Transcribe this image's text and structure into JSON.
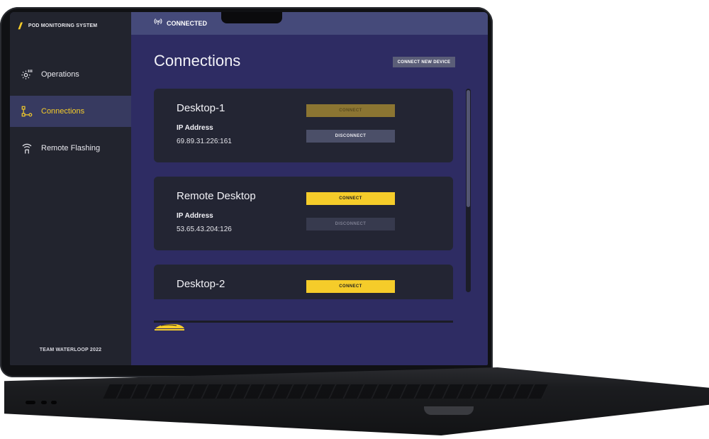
{
  "app": {
    "name": "POD MONITORING SYSTEM",
    "logo_text": "///",
    "footer": "TEAM WATERLOOP 2022"
  },
  "sidebar": {
    "items": [
      {
        "label": "Operations",
        "icon": "gear-icon",
        "active": false
      },
      {
        "label": "Connections",
        "icon": "connections-icon",
        "active": true
      },
      {
        "label": "Remote Flashing",
        "icon": "antenna-icon",
        "active": false
      }
    ]
  },
  "topbar": {
    "status_text": "CONNECTED",
    "status_icon": "signal-icon"
  },
  "main": {
    "title": "Connections",
    "new_device_label": "CONNECT NEW DEVICE",
    "devices": [
      {
        "name": "Desktop-1",
        "ip_label": "IP Address",
        "ip": "69.89.31.226:161",
        "connect_label": "CONNECT",
        "disconnect_label": "DISCONNECT"
      },
      {
        "name": "Remote Desktop",
        "ip_label": "IP Address",
        "ip": "53.65.43.204:126",
        "connect_label": "CONNECT",
        "disconnect_label": "DISCONNECT"
      },
      {
        "name": "Desktop-2",
        "connect_label": "CONNECT"
      }
    ]
  },
  "colors": {
    "accent": "#f5cc2a",
    "sidebar_bg": "#22242e",
    "main_bg": "#2e2c63",
    "card_bg": "#232533"
  }
}
